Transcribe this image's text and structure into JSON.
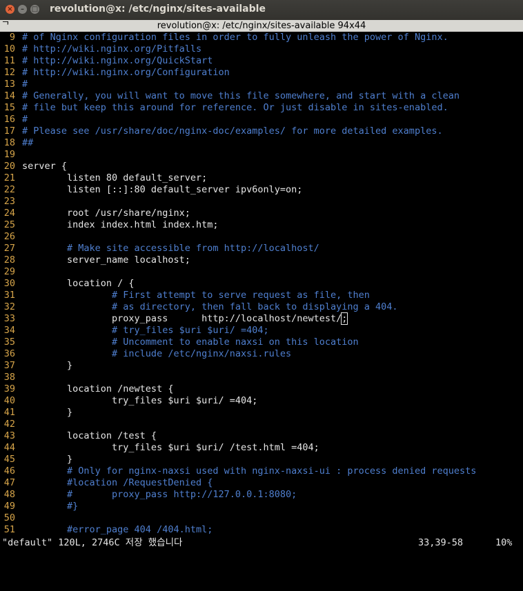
{
  "window": {
    "title": "revolution@x: /etc/nginx/sites-available"
  },
  "terminal": {
    "title": "revolution@x: /etc/nginx/sites-available 94x44",
    "corner_marker": "ᄀ"
  },
  "colors": {
    "line_number": "#d7a54a",
    "comment": "#4f7fcf",
    "text": "#e6e6e6",
    "background": "#000000"
  },
  "editor": {
    "lines": [
      {
        "num": "9",
        "type": "comment",
        "text": "# of Nginx configuration files in order to fully unleash the power of Nginx."
      },
      {
        "num": "10",
        "type": "comment",
        "text": "# http://wiki.nginx.org/Pitfalls"
      },
      {
        "num": "11",
        "type": "comment",
        "text": "# http://wiki.nginx.org/QuickStart"
      },
      {
        "num": "12",
        "type": "comment",
        "text": "# http://wiki.nginx.org/Configuration"
      },
      {
        "num": "13",
        "type": "comment",
        "text": "#"
      },
      {
        "num": "14",
        "type": "comment",
        "text": "# Generally, you will want to move this file somewhere, and start with a clean"
      },
      {
        "num": "15",
        "type": "comment",
        "text": "# file but keep this around for reference. Or just disable in sites-enabled."
      },
      {
        "num": "16",
        "type": "comment",
        "text": "#"
      },
      {
        "num": "17",
        "type": "comment",
        "text": "# Please see /usr/share/doc/nginx-doc/examples/ for more detailed examples."
      },
      {
        "num": "18",
        "type": "comment",
        "text": "##"
      },
      {
        "num": "19",
        "type": "text",
        "text": ""
      },
      {
        "num": "20",
        "type": "text",
        "text": "server {"
      },
      {
        "num": "21",
        "type": "text",
        "text": "        listen 80 default_server;"
      },
      {
        "num": "22",
        "type": "text",
        "text": "        listen [::]:80 default_server ipv6only=on;"
      },
      {
        "num": "23",
        "type": "text",
        "text": ""
      },
      {
        "num": "24",
        "type": "text",
        "text": "        root /usr/share/nginx;"
      },
      {
        "num": "25",
        "type": "text",
        "text": "        index index.html index.htm;"
      },
      {
        "num": "26",
        "type": "text",
        "text": ""
      },
      {
        "num": "27",
        "type": "comment",
        "text": "        # Make site accessible from http://localhost/"
      },
      {
        "num": "28",
        "type": "text",
        "text": "        server_name localhost;"
      },
      {
        "num": "29",
        "type": "text",
        "text": ""
      },
      {
        "num": "30",
        "type": "text",
        "text": "        location / {"
      },
      {
        "num": "31",
        "type": "comment",
        "text": "                # First attempt to serve request as file, then"
      },
      {
        "num": "32",
        "type": "comment",
        "text": "                # as directory, then fall back to displaying a 404."
      },
      {
        "num": "33",
        "type": "cursor",
        "text": "                proxy_pass      http://localhost/newtest/",
        "cursor_char": ";"
      },
      {
        "num": "34",
        "type": "comment",
        "text": "                # try_files $uri $uri/ =404;"
      },
      {
        "num": "35",
        "type": "comment",
        "text": "                # Uncomment to enable naxsi on this location"
      },
      {
        "num": "36",
        "type": "comment",
        "text": "                # include /etc/nginx/naxsi.rules"
      },
      {
        "num": "37",
        "type": "text",
        "text": "        }"
      },
      {
        "num": "38",
        "type": "text",
        "text": ""
      },
      {
        "num": "39",
        "type": "text",
        "text": "        location /newtest {"
      },
      {
        "num": "40",
        "type": "text",
        "text": "                try_files $uri $uri/ =404;"
      },
      {
        "num": "41",
        "type": "text",
        "text": "        }"
      },
      {
        "num": "42",
        "type": "text",
        "text": ""
      },
      {
        "num": "43",
        "type": "text",
        "text": "        location /test {"
      },
      {
        "num": "44",
        "type": "text",
        "text": "                try_files $uri $uri/ /test.html =404;"
      },
      {
        "num": "45",
        "type": "text",
        "text": "        }"
      },
      {
        "num": "46",
        "type": "comment",
        "text": "        # Only for nginx-naxsi used with nginx-naxsi-ui : process denied requests"
      },
      {
        "num": "47",
        "type": "comment",
        "text": "        #location /RequestDenied {"
      },
      {
        "num": "48",
        "type": "comment",
        "text": "        #       proxy_pass http://127.0.0.1:8080;"
      },
      {
        "num": "49",
        "type": "comment",
        "text": "        #}"
      },
      {
        "num": "50",
        "type": "text",
        "text": ""
      },
      {
        "num": "51",
        "type": "comment",
        "text": "        #error_page 404 /404.html;"
      }
    ]
  },
  "status_bar": {
    "message": "\"default\" 120L, 2746C 저장 했습니다",
    "position": "33,39-58",
    "percent": "10%"
  }
}
